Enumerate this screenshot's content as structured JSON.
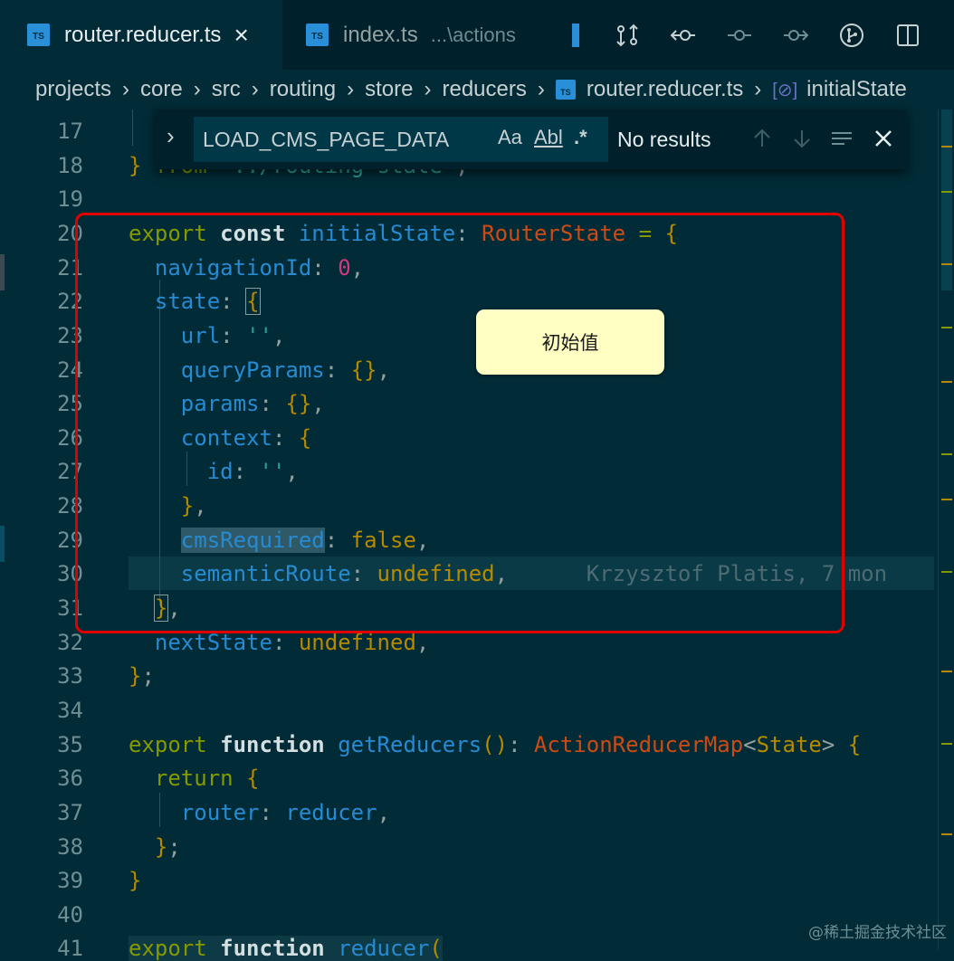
{
  "tabs": [
    {
      "label": "router.reducer.ts",
      "icon": "TS",
      "active": true,
      "close": "×"
    },
    {
      "label": "index.ts",
      "icon": "TS",
      "desc": "...\\actions",
      "active": false
    }
  ],
  "toolbar_actions": [
    "open-changes-icon",
    "previous-change-icon",
    "timeline-icon",
    "next-change-icon",
    "git-icon",
    "split-editor-icon"
  ],
  "breadcrumb": {
    "items": [
      "projects",
      "core",
      "src",
      "routing",
      "store",
      "reducers",
      "router.reducer.ts",
      "initialState"
    ]
  },
  "find": {
    "query": "LOAD_CMS_PAGE_DATA",
    "match_case": "Aa",
    "whole_word": "Abl",
    "regex": ".*",
    "result": "No results"
  },
  "gutter": [
    "17",
    "18",
    "19",
    "20",
    "21",
    "22",
    "23",
    "24",
    "25",
    "26",
    "27",
    "28",
    "29",
    "30",
    "31",
    "32",
    "33",
    "34",
    "35",
    "36",
    "37",
    "38",
    "39",
    "40",
    "41"
  ],
  "blame": "Krzysztof Platis, 7 mon",
  "annotation": {
    "note": "初始值"
  },
  "watermark": "@稀土掘金技术社区"
}
